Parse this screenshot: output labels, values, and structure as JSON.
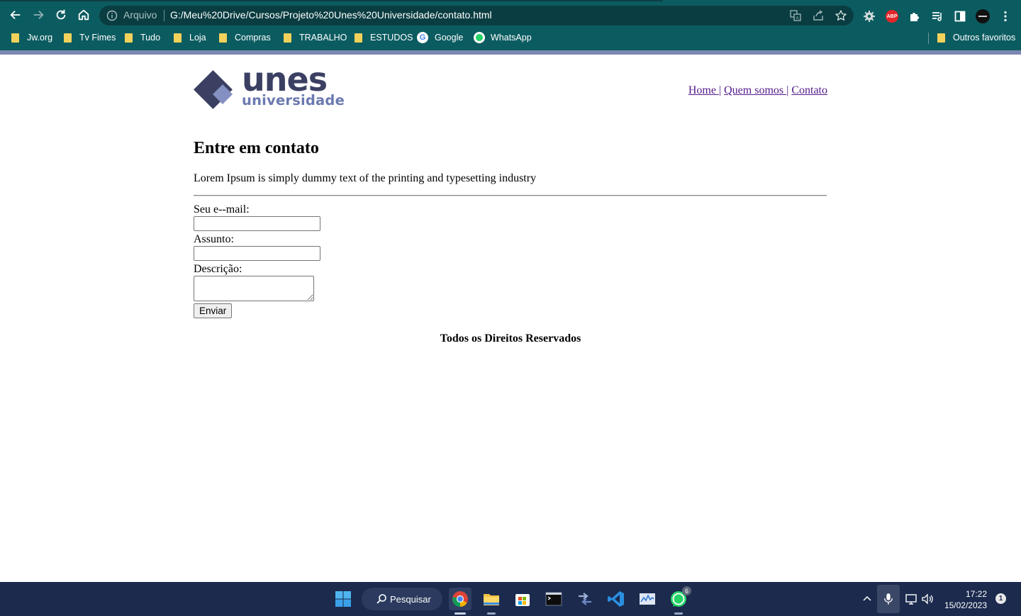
{
  "browser": {
    "omnibox": {
      "scheme_label": "Arquivo",
      "url": "G:/Meu%20Drive/Cursos/Projeto%20Unes%20Universidade/contato.html"
    },
    "bookmarks": [
      {
        "label": "Jw.org",
        "icon": "folder-icon"
      },
      {
        "label": "Tv Fimes",
        "icon": "folder-icon"
      },
      {
        "label": "Tudo",
        "icon": "folder-icon"
      },
      {
        "label": "Loja",
        "icon": "folder-icon"
      },
      {
        "label": "Compras",
        "icon": "folder-icon"
      },
      {
        "label": "TRABALHO",
        "icon": "folder-icon"
      },
      {
        "label": "ESTUDOS",
        "icon": "folder-icon"
      },
      {
        "label": "Google",
        "icon": "google-icon"
      },
      {
        "label": "WhatsApp",
        "icon": "whatsapp-icon"
      }
    ],
    "other_bookmarks": "Outros favoritos",
    "extensions": {
      "abp_label": "ABP"
    }
  },
  "site": {
    "logo": {
      "word": "unes",
      "sub": "universidade"
    },
    "nav": [
      {
        "label": "Home "
      },
      {
        "label": "Quem somos "
      },
      {
        "label": "Contato"
      }
    ],
    "nav_separator": "|",
    "title": "Entre em contato",
    "lead": "Lorem Ipsum is simply dummy text of the printing and typesetting industry",
    "form": {
      "email_label": "Seu e--mail:",
      "email_value": "",
      "subject_label": "Assunto:",
      "subject_value": "",
      "description_label": "Descrição:",
      "description_value": "",
      "submit_label": "Enviar"
    },
    "footer": "Todos os Direitos Reservados"
  },
  "taskbar": {
    "search_label": "Pesquisar",
    "whatsapp_badge": "6",
    "time": "17:22",
    "date": "15/02/2023",
    "notifications": "1"
  },
  "colors": {
    "chrome_bg": "#0b5c60",
    "omnibox_bg": "#0a3d41",
    "logo_dark": "#3b4063",
    "logo_light": "#6b7ab0",
    "link_visited": "#551a8b",
    "taskbar_bg": "#1b2a4d"
  }
}
